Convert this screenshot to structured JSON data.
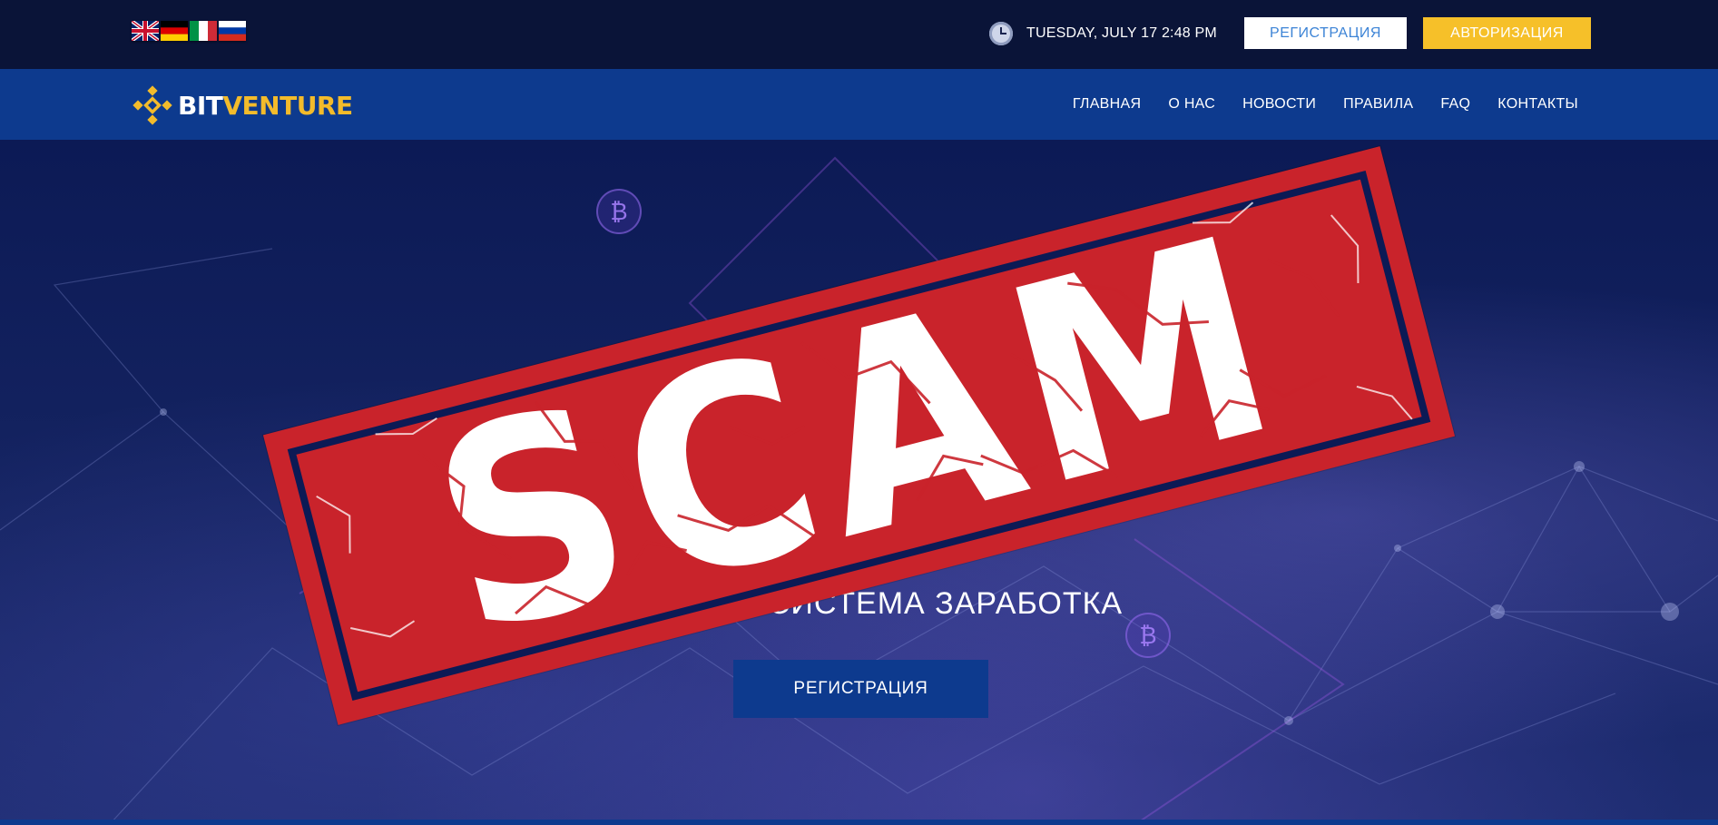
{
  "topbar": {
    "languages": [
      {
        "name": "english",
        "icon": "uk-flag-icon"
      },
      {
        "name": "german",
        "icon": "germany-flag-icon"
      },
      {
        "name": "italian",
        "icon": "italy-flag-icon"
      },
      {
        "name": "russian",
        "icon": "russia-flag-icon"
      }
    ],
    "clock_icon": "clock-icon",
    "datetime": "TUESDAY, JULY 17 2:48 PM",
    "register_label": "РЕГИСТРАЦИЯ",
    "login_label": "АВТОРИЗАЦИЯ"
  },
  "navbar": {
    "logo_bit": "BIT",
    "logo_venture": "VENTURE",
    "items": [
      {
        "label": "ГЛАВНАЯ"
      },
      {
        "label": "О НАС"
      },
      {
        "label": "НОВОСТИ"
      },
      {
        "label": "ПРАВИЛА"
      },
      {
        "label": "FAQ"
      },
      {
        "label": "КОНТАКТЫ"
      }
    ]
  },
  "hero": {
    "title": "",
    "subtitle": "СИСТЕМА ЗАРАБОТКА",
    "register_label": "РЕГИСТРАЦИЯ",
    "coin_symbol": "₿"
  },
  "stamp": {
    "text": "SCAM"
  },
  "colors": {
    "topbar_bg": "#0a1438",
    "navbar_bg": "#0d3a8e",
    "accent_yellow": "#f6c029",
    "stamp_red": "#c9232b"
  }
}
